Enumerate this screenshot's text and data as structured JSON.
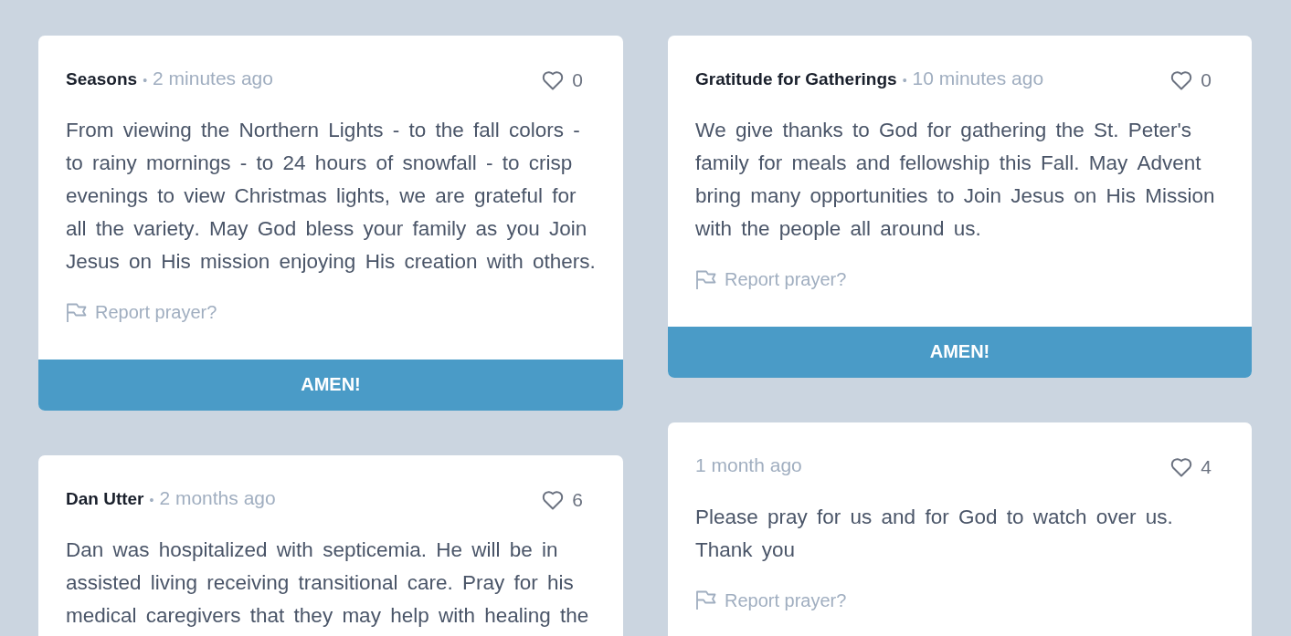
{
  "columns": [
    {
      "cards": [
        {
          "title": "Seasons",
          "separator": "•",
          "time": "2 minutes ago",
          "likes": "0",
          "body": "From viewing the Northern Lights - to the fall colors - to rainy mornings - to 24 hours of snowfall - to crisp evenings to view Christmas lights, we are grateful for all the variety. May God bless your family as you Join Jesus on His mission enjoying His creation with others.",
          "report": "Report prayer?",
          "button": "AMEN!"
        },
        {
          "title": "Dan Utter",
          "separator": "•",
          "time": "2 months ago",
          "likes": "6",
          "body": "Dan was hospitalized with septicemia. He will be in assisted living receiving transitional care. Pray for his medical caregivers that they may help with healing the"
        }
      ]
    },
    {
      "cards": [
        {
          "title": "Gratitude for Gatherings",
          "separator": "•",
          "time": "10 minutes ago",
          "likes": "0",
          "body": "We give thanks to God for gathering the St. Peter's family for meals and fellowship this Fall. May Advent bring many opportunities to Join Jesus on His Mission with the people all around us.",
          "report": "Report prayer?",
          "button": "AMEN!"
        },
        {
          "time": "1 month ago",
          "likes": "4",
          "body": "Please pray for us and for God to watch over us. Thank you",
          "report": "Report prayer?"
        }
      ]
    }
  ]
}
